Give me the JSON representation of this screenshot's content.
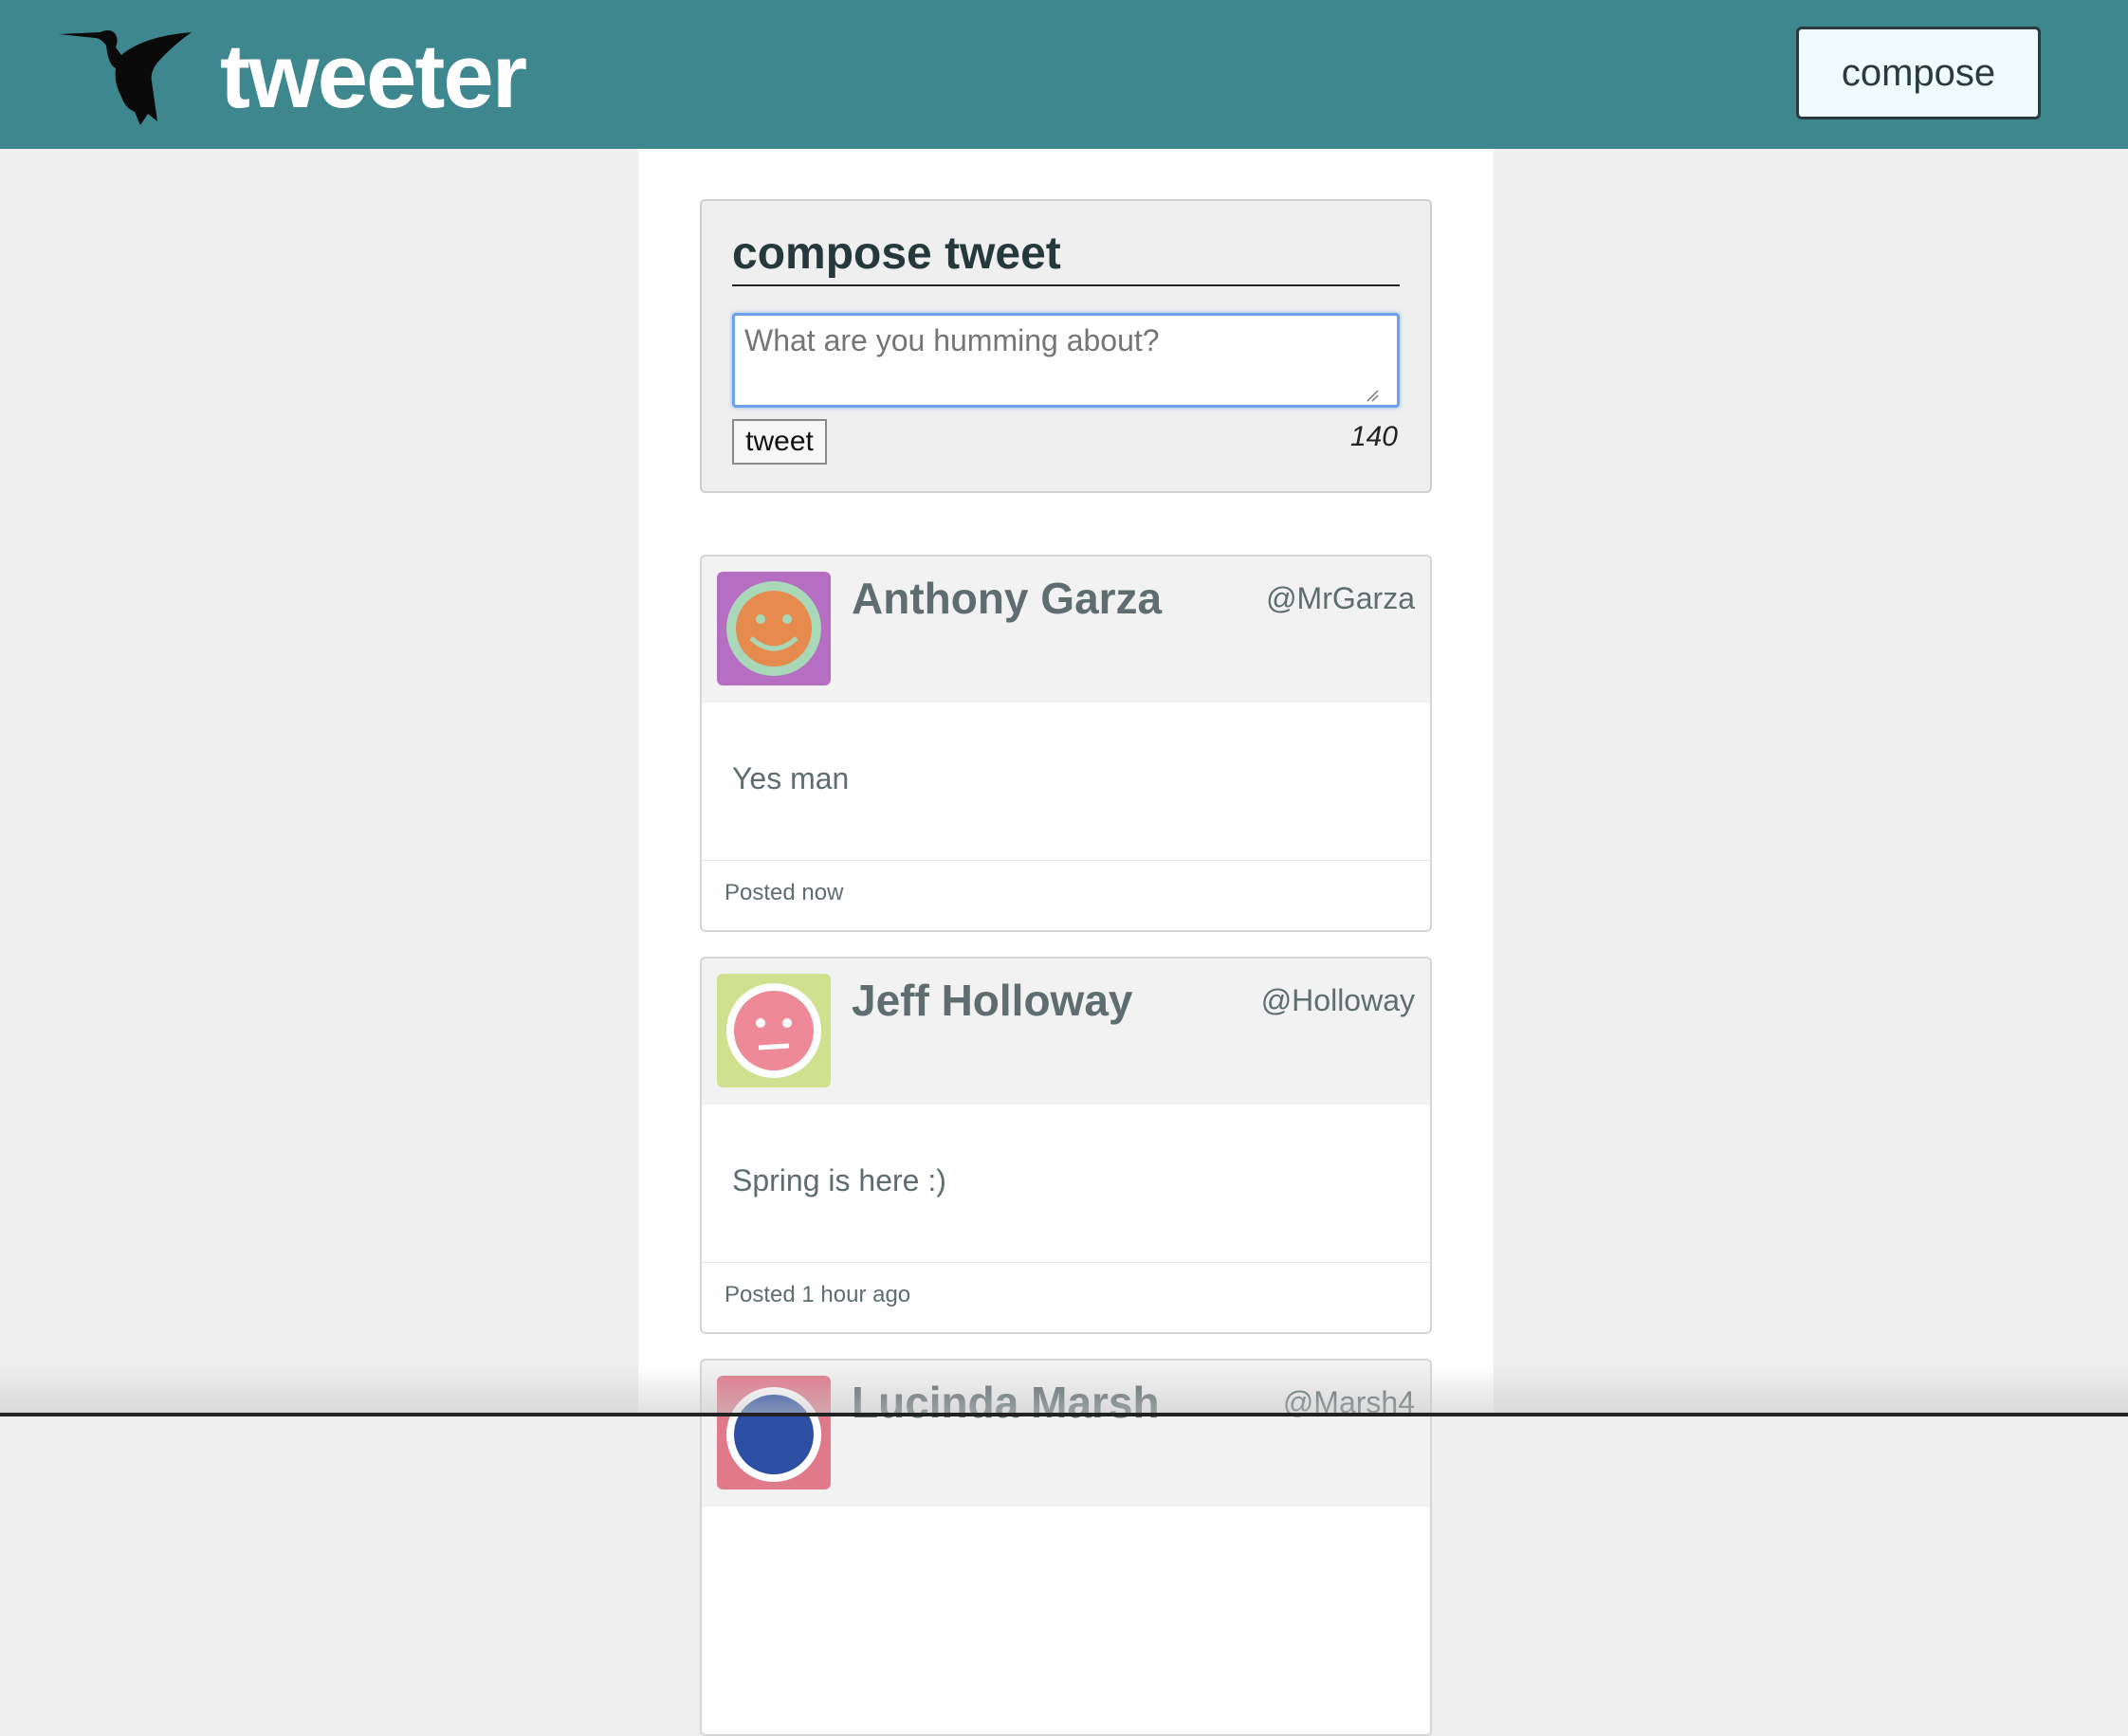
{
  "header": {
    "brand": "tweeter",
    "compose_label": "compose",
    "logo_icon": "hummingbird-icon",
    "bg_color": "#3e878f"
  },
  "compose": {
    "title": "compose tweet",
    "placeholder": "What are you humming about?",
    "submit_label": "tweet",
    "counter": "140"
  },
  "tweets": [
    {
      "name": "Anthony Garza",
      "handle": "@MrGarza",
      "text": "Yes man",
      "time": "Posted now",
      "avatar_icon": "smiley-avatar-icon",
      "avatar_bg": "#b56ec2"
    },
    {
      "name": "Jeff Holloway",
      "handle": "@Holloway",
      "text": "Spring is here :)",
      "time": "Posted 1 hour ago",
      "avatar_icon": "neutral-face-avatar-icon",
      "avatar_bg": "#cfe08e"
    },
    {
      "name": "Lucinda Marsh",
      "handle": "@Marsh4",
      "avatar_icon": "face-avatar-icon",
      "avatar_bg": "#e07a8a"
    }
  ]
}
